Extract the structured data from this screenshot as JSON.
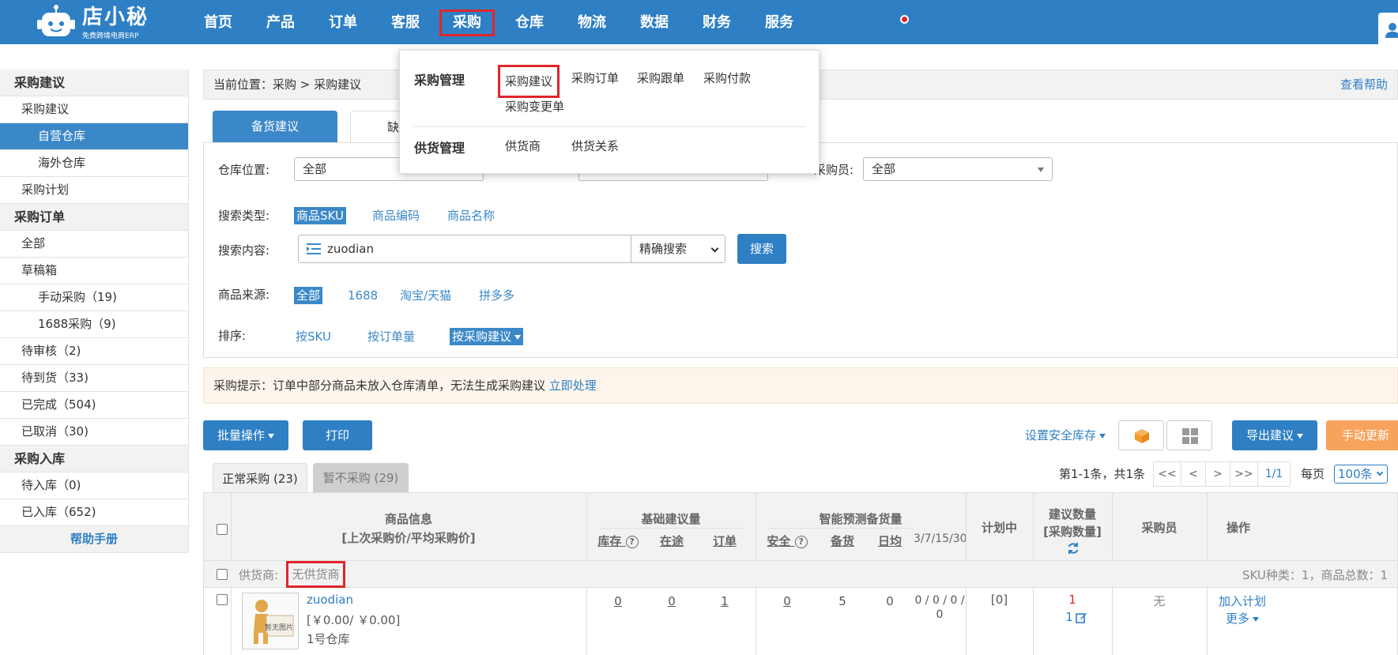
{
  "app": {
    "logo_title": "店小秘",
    "logo_subtitle": "免费跨境电商ERP"
  },
  "nav": [
    {
      "label": "首页"
    },
    {
      "label": "产品"
    },
    {
      "label": "订单"
    },
    {
      "label": "客服"
    },
    {
      "label": "采购"
    },
    {
      "label": "仓库"
    },
    {
      "label": "物流"
    },
    {
      "label": "数据"
    },
    {
      "label": "财务"
    },
    {
      "label": "服务"
    }
  ],
  "dropdown": {
    "group1": {
      "title": "采购管理",
      "links": [
        "采购建议",
        "采购订单",
        "采购跟单",
        "采购付款",
        "采购变更单"
      ]
    },
    "group2": {
      "title": "供货管理",
      "links": [
        "供货商",
        "供货关系"
      ]
    }
  },
  "sidebar": {
    "s1": {
      "title": "采购建议",
      "items": [
        "采购建议",
        "自营仓库",
        "海外仓库",
        "采购计划"
      ]
    },
    "s2": {
      "title": "采购订单",
      "items": [
        "全部",
        "草稿箱",
        "手动采购（19)",
        "1688采购（9)",
        "待审核（2)",
        "待到货（33)",
        "已完成（504)",
        "已取消（30)"
      ]
    },
    "s3": {
      "title": "采购入库",
      "items": [
        "待入库（0)",
        "已入库（652)"
      ]
    },
    "help": "帮助手册"
  },
  "breadcrumb": {
    "text": "当前位置：采购 > 采购建议",
    "help": "查看帮助"
  },
  "tabs": {
    "active": "备货建议",
    "other": "缺"
  },
  "filters": {
    "warehouse_label": "仓库位置:",
    "warehouse_value": "全部",
    "mid_label": "",
    "buyer_label": "采购员:",
    "buyer_value": "全部",
    "search_type_label": "搜索类型:",
    "search_types": [
      "商品SKU",
      "商品编码",
      "商品名称"
    ],
    "search_content_label": "搜索内容:",
    "search_value": "zuodian",
    "search_mode": "精确搜索",
    "search_button": "搜索",
    "source_label": "商品来源:",
    "sources": [
      "全部",
      "1688",
      "淘宝/天猫",
      "拼多多"
    ],
    "sort_label": "排序:",
    "sorts": [
      "按SKU",
      "按订单量",
      "按采购建议"
    ]
  },
  "notice": {
    "text": "采购提示：订单中部分商品未放入仓库清单，无法生成采购建议",
    "link": "立即处理"
  },
  "toolbar": {
    "batch": "批量操作",
    "print": "打印",
    "safety_stock": "设置安全库存",
    "export": "导出建议",
    "manual_update": "手动更新"
  },
  "subtabs": {
    "normal": "正常采购 (23)",
    "paused": "暂不采购 (29)"
  },
  "pagination": {
    "summary": "第1-1条，共1条",
    "first": "<<",
    "prev": "<",
    "next": ">",
    "last": ">>",
    "page": "1/1",
    "per_page_label": "每页",
    "per_page": "100条"
  },
  "table": {
    "headers": {
      "product_info": "商品信息",
      "product_info_sub": "[上次采购价/平均采购价]",
      "basic": "基础建议量",
      "stock": "库存",
      "transit": "在途",
      "order": "订单",
      "smart": "智能预测备货量",
      "safety": "安全",
      "prep": "备货",
      "daily": "日均",
      "periods": "3/7/15/30",
      "planning": "计划中",
      "suggest": "建议数量",
      "suggest_sub": "[采购数量]",
      "buyer": "采购员",
      "action": "操作"
    },
    "supplier": {
      "label": "供货商:",
      "value": "无供货商",
      "summary": "SKU种类：1，商品总数：1"
    },
    "row": {
      "thumb_text": "暂无图片",
      "name": "zuodian",
      "price": "[￥0.00/ ￥0.00]",
      "warehouse": "1号仓库",
      "stock": "0",
      "transit": "0",
      "order": "1",
      "safety": "0",
      "prep": "5",
      "daily": "0",
      "periods_line1": "0 / 0 / 0 /",
      "periods_line2": "0",
      "planning": "[0]",
      "suggest": "1",
      "purchase_qty": "1",
      "buyer": "无",
      "action_add": "加入计划",
      "action_more": "更多"
    }
  },
  "colors": {
    "brand": "#2e7fc4",
    "highlight": "#e0262b",
    "orange": "#f7a35c"
  }
}
